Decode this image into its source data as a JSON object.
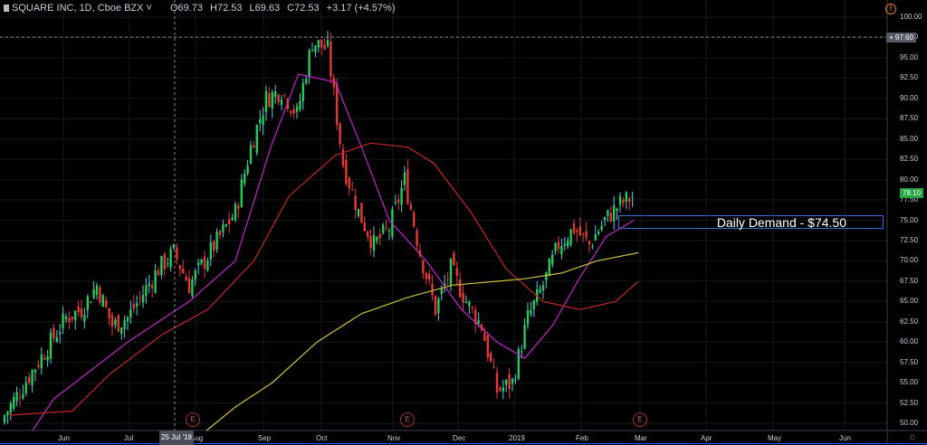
{
  "header": {
    "symbol": "SQUARE INC, 1D, Cboe BZX",
    "open": "O69.73",
    "high": "H72.53",
    "low": "L69.63",
    "close": "C72.53",
    "change": "+3.17 (+4.57%)"
  },
  "price_axis": [
    "100.00",
    "97.50",
    "95.00",
    "92.50",
    "90.00",
    "87.50",
    "85.00",
    "82.50",
    "80.00",
    "77.50",
    "75.00",
    "72.50",
    "70.00",
    "67.50",
    "65.00",
    "62.50",
    "60.00",
    "57.50",
    "55.00",
    "52.50",
    "50.00"
  ],
  "crosshair_price": "97.60",
  "last_price": "78.10",
  "crosshair_date": "25 Jul '18",
  "time_axis": [
    "Jun",
    "Jul",
    "Aug",
    "Sep",
    "Oct",
    "Nov",
    "Dec",
    "2019",
    "Feb",
    "Mar",
    "Apr",
    "May",
    "Jun"
  ],
  "annotation": "Daily Demand - $74.50",
  "earnings_marker": "E",
  "colors": {
    "up": "#26c95a",
    "down": "#e53935",
    "wick_up": "#4dd0e1",
    "ma_fast": "#c026c9",
    "ma_mid": "#c62828",
    "ma_slow": "#c9c23a",
    "demand": "#3a6fd8"
  },
  "chart_data": {
    "type": "candlestick",
    "x_unit": "weeks since mid-May 2018",
    "weekly_closes": [
      51,
      54,
      57,
      60,
      63,
      64,
      67,
      62,
      63,
      66,
      69,
      71,
      67,
      70,
      73,
      76,
      84,
      90,
      91,
      88,
      97,
      96,
      82,
      76,
      72,
      74,
      80,
      71,
      64,
      69,
      65,
      62,
      54,
      55,
      63,
      67,
      72,
      74,
      72,
      75,
      77,
      78.1
    ],
    "ma_fast": [
      [
        0,
        44
      ],
      [
        3.2,
        53
      ],
      [
        8,
        60
      ],
      [
        12,
        65
      ],
      [
        15,
        70
      ],
      [
        17.3,
        84
      ],
      [
        19.1,
        93
      ],
      [
        21.5,
        92
      ],
      [
        23.2,
        84
      ],
      [
        25,
        75
      ],
      [
        27.4,
        70
      ],
      [
        29.7,
        64
      ],
      [
        32,
        60
      ],
      [
        33.8,
        58
      ],
      [
        35.6,
        62
      ],
      [
        37.4,
        68
      ],
      [
        39.1,
        73
      ],
      [
        40.9,
        75
      ]
    ],
    "ma_mid": [
      [
        0.3,
        51
      ],
      [
        4.4,
        51.5
      ],
      [
        6.8,
        56
      ],
      [
        10.3,
        61
      ],
      [
        13.2,
        64
      ],
      [
        16.2,
        70
      ],
      [
        18.5,
        78
      ],
      [
        21.5,
        83
      ],
      [
        23.8,
        84.5
      ],
      [
        26.2,
        84
      ],
      [
        27.9,
        82
      ],
      [
        30.3,
        76
      ],
      [
        32.6,
        69
      ],
      [
        35,
        65
      ],
      [
        37.4,
        64
      ],
      [
        39.7,
        65
      ],
      [
        41.2,
        67.5
      ]
    ],
    "ma_slow": [
      [
        12.4,
        48
      ],
      [
        15,
        52
      ],
      [
        17.4,
        55
      ],
      [
        20.3,
        60
      ],
      [
        23.2,
        63.5
      ],
      [
        26.2,
        65.5
      ],
      [
        29.1,
        67
      ],
      [
        32.1,
        67.5
      ],
      [
        33.8,
        67.8
      ],
      [
        36.2,
        68.5
      ],
      [
        38.5,
        70
      ],
      [
        41.2,
        71
      ]
    ],
    "ylim": [
      49,
      101
    ]
  }
}
